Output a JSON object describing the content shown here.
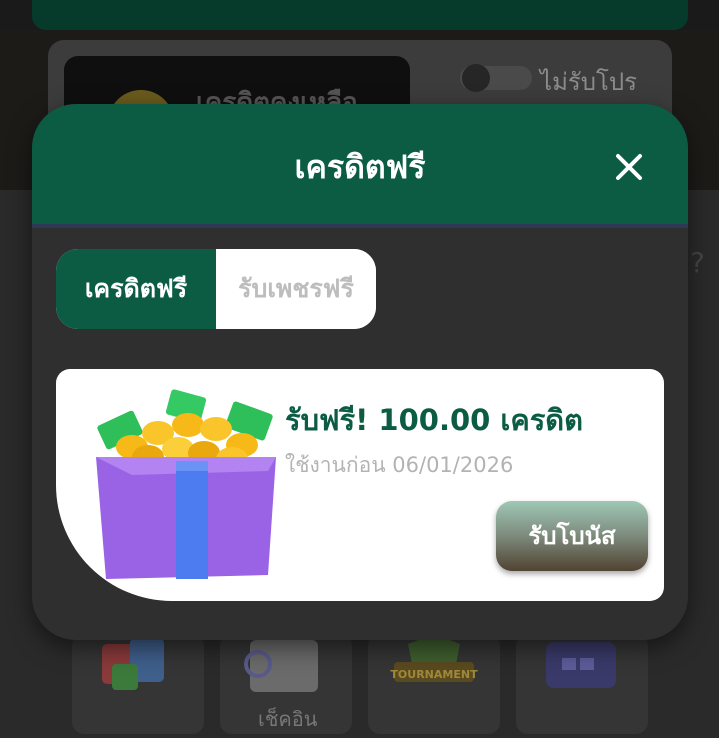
{
  "background": {
    "credit_label": "เครดิตคงเหลือ",
    "promo_toggle_label": "ไม่รับโปร",
    "bottom_menu": [
      {
        "icon": "shop-bag-icon"
      },
      {
        "icon": "calendar-checkin-icon",
        "label": "เช็คอิน"
      },
      {
        "icon": "tournament-icon",
        "logo_text": "TOURNAMENT"
      },
      {
        "icon": "store-icon"
      }
    ]
  },
  "modal": {
    "title": "เครดิตฟรี",
    "close_icon": "close-icon",
    "tabs": [
      {
        "label": "เครดิตฟรี",
        "active": true
      },
      {
        "label": "รับเพชรฟรี",
        "active": false
      }
    ],
    "offer": {
      "icon": "gift-box-coins-icon",
      "title": "รับฟรี! 100.00 เครดิต",
      "expiry": "ใช้งานก่อน 06/01/2026",
      "claim_label": "รับโบนัส"
    }
  },
  "colors": {
    "brand_green": "#0b5c43",
    "modal_bg": "#2f2f2f",
    "offer_bg": "#ffffff",
    "muted_text": "#b3b3b3"
  }
}
